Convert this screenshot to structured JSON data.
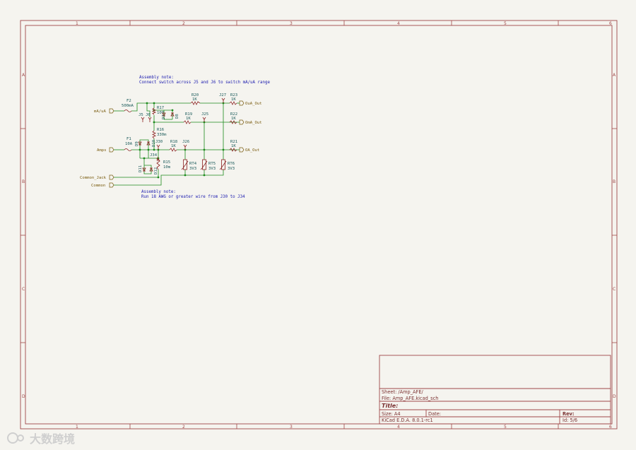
{
  "ruler": {
    "cols": [
      "1",
      "2",
      "3",
      "4",
      "5",
      "6"
    ],
    "rows": [
      "A",
      "B",
      "C",
      "D"
    ]
  },
  "notes": {
    "assembly_1_title": "Assembly note:",
    "assembly_1_text": "Connect switch across J5 and J6 to switch mA/uA range",
    "assembly_2_title": "Assembly note:",
    "assembly_2_text": "Run 18 AWG or greater wire from J30 to J34"
  },
  "ports": {
    "ma_ua": "mA/uA",
    "amps": "Amps",
    "common_jack": "Common_Jack",
    "common": "Common",
    "oua_out": "OuA_Out",
    "oma_out": "OmA_Out",
    "oa_out": "OA_Out"
  },
  "components": {
    "f2": "F2",
    "f2_val": "500mA",
    "f1": "F1",
    "f1_val": "10A",
    "j5": "J5",
    "j6": "J6",
    "r17": "R17",
    "r17_val": "100",
    "r16": "R16",
    "r16_val": "330m",
    "r15": "R15",
    "r15_val": "10m",
    "r20": "R20",
    "r20_val": "1K",
    "r23": "R23",
    "r23_val": "1K",
    "r19": "R19",
    "r19_val": "1K",
    "r22": "R22",
    "r22_val": "1K",
    "r18": "R18",
    "r18_val": "1K",
    "r21": "R21",
    "r21_val": "1K",
    "j27": "J27",
    "j25": "J25",
    "j30": "J30",
    "j26": "J26",
    "j34": "J34",
    "d9": "D9",
    "d10": "D10",
    "d11": "D11",
    "d12": "D12",
    "d7": "D7",
    "d8": "D8",
    "rt4": "RT4",
    "rt4_val": "3V3",
    "rt5": "RT5",
    "rt5_val": "3V3",
    "rt6": "RT6",
    "rt6_val": "3V3"
  },
  "title_block": {
    "sheet": "Sheet: /Amp_AFE/",
    "file": "File: Amp_AFE.kicad_sch",
    "title_label": "Title:",
    "size": "Size: A4",
    "date": "Date:",
    "rev": "Rev:",
    "tool": "KiCad E.D.A. 8.0.1-rc1",
    "id": "Id: 5/6"
  },
  "watermark": "大数跨境"
}
